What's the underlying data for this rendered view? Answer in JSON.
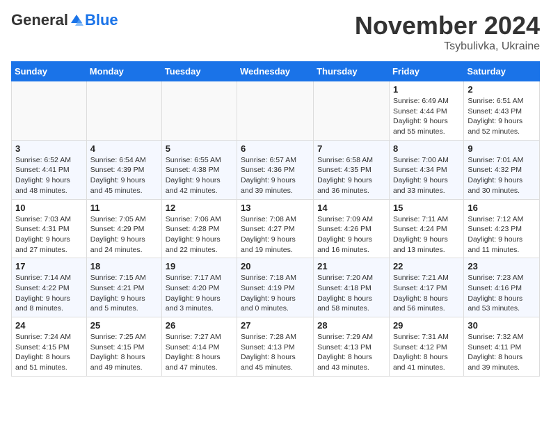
{
  "header": {
    "logo": {
      "general": "General",
      "blue": "Blue"
    },
    "title": "November 2024",
    "subtitle": "Tsybulivka, Ukraine"
  },
  "weekdays": [
    "Sunday",
    "Monday",
    "Tuesday",
    "Wednesday",
    "Thursday",
    "Friday",
    "Saturday"
  ],
  "weeks": [
    [
      {
        "day": "",
        "info": ""
      },
      {
        "day": "",
        "info": ""
      },
      {
        "day": "",
        "info": ""
      },
      {
        "day": "",
        "info": ""
      },
      {
        "day": "",
        "info": ""
      },
      {
        "day": "1",
        "info": "Sunrise: 6:49 AM\nSunset: 4:44 PM\nDaylight: 9 hours\nand 55 minutes."
      },
      {
        "day": "2",
        "info": "Sunrise: 6:51 AM\nSunset: 4:43 PM\nDaylight: 9 hours\nand 52 minutes."
      }
    ],
    [
      {
        "day": "3",
        "info": "Sunrise: 6:52 AM\nSunset: 4:41 PM\nDaylight: 9 hours\nand 48 minutes."
      },
      {
        "day": "4",
        "info": "Sunrise: 6:54 AM\nSunset: 4:39 PM\nDaylight: 9 hours\nand 45 minutes."
      },
      {
        "day": "5",
        "info": "Sunrise: 6:55 AM\nSunset: 4:38 PM\nDaylight: 9 hours\nand 42 minutes."
      },
      {
        "day": "6",
        "info": "Sunrise: 6:57 AM\nSunset: 4:36 PM\nDaylight: 9 hours\nand 39 minutes."
      },
      {
        "day": "7",
        "info": "Sunrise: 6:58 AM\nSunset: 4:35 PM\nDaylight: 9 hours\nand 36 minutes."
      },
      {
        "day": "8",
        "info": "Sunrise: 7:00 AM\nSunset: 4:34 PM\nDaylight: 9 hours\nand 33 minutes."
      },
      {
        "day": "9",
        "info": "Sunrise: 7:01 AM\nSunset: 4:32 PM\nDaylight: 9 hours\nand 30 minutes."
      }
    ],
    [
      {
        "day": "10",
        "info": "Sunrise: 7:03 AM\nSunset: 4:31 PM\nDaylight: 9 hours\nand 27 minutes."
      },
      {
        "day": "11",
        "info": "Sunrise: 7:05 AM\nSunset: 4:29 PM\nDaylight: 9 hours\nand 24 minutes."
      },
      {
        "day": "12",
        "info": "Sunrise: 7:06 AM\nSunset: 4:28 PM\nDaylight: 9 hours\nand 22 minutes."
      },
      {
        "day": "13",
        "info": "Sunrise: 7:08 AM\nSunset: 4:27 PM\nDaylight: 9 hours\nand 19 minutes."
      },
      {
        "day": "14",
        "info": "Sunrise: 7:09 AM\nSunset: 4:26 PM\nDaylight: 9 hours\nand 16 minutes."
      },
      {
        "day": "15",
        "info": "Sunrise: 7:11 AM\nSunset: 4:24 PM\nDaylight: 9 hours\nand 13 minutes."
      },
      {
        "day": "16",
        "info": "Sunrise: 7:12 AM\nSunset: 4:23 PM\nDaylight: 9 hours\nand 11 minutes."
      }
    ],
    [
      {
        "day": "17",
        "info": "Sunrise: 7:14 AM\nSunset: 4:22 PM\nDaylight: 9 hours\nand 8 minutes."
      },
      {
        "day": "18",
        "info": "Sunrise: 7:15 AM\nSunset: 4:21 PM\nDaylight: 9 hours\nand 5 minutes."
      },
      {
        "day": "19",
        "info": "Sunrise: 7:17 AM\nSunset: 4:20 PM\nDaylight: 9 hours\nand 3 minutes."
      },
      {
        "day": "20",
        "info": "Sunrise: 7:18 AM\nSunset: 4:19 PM\nDaylight: 9 hours\nand 0 minutes."
      },
      {
        "day": "21",
        "info": "Sunrise: 7:20 AM\nSunset: 4:18 PM\nDaylight: 8 hours\nand 58 minutes."
      },
      {
        "day": "22",
        "info": "Sunrise: 7:21 AM\nSunset: 4:17 PM\nDaylight: 8 hours\nand 56 minutes."
      },
      {
        "day": "23",
        "info": "Sunrise: 7:23 AM\nSunset: 4:16 PM\nDaylight: 8 hours\nand 53 minutes."
      }
    ],
    [
      {
        "day": "24",
        "info": "Sunrise: 7:24 AM\nSunset: 4:15 PM\nDaylight: 8 hours\nand 51 minutes."
      },
      {
        "day": "25",
        "info": "Sunrise: 7:25 AM\nSunset: 4:15 PM\nDaylight: 8 hours\nand 49 minutes."
      },
      {
        "day": "26",
        "info": "Sunrise: 7:27 AM\nSunset: 4:14 PM\nDaylight: 8 hours\nand 47 minutes."
      },
      {
        "day": "27",
        "info": "Sunrise: 7:28 AM\nSunset: 4:13 PM\nDaylight: 8 hours\nand 45 minutes."
      },
      {
        "day": "28",
        "info": "Sunrise: 7:29 AM\nSunset: 4:13 PM\nDaylight: 8 hours\nand 43 minutes."
      },
      {
        "day": "29",
        "info": "Sunrise: 7:31 AM\nSunset: 4:12 PM\nDaylight: 8 hours\nand 41 minutes."
      },
      {
        "day": "30",
        "info": "Sunrise: 7:32 AM\nSunset: 4:11 PM\nDaylight: 8 hours\nand 39 minutes."
      }
    ]
  ]
}
